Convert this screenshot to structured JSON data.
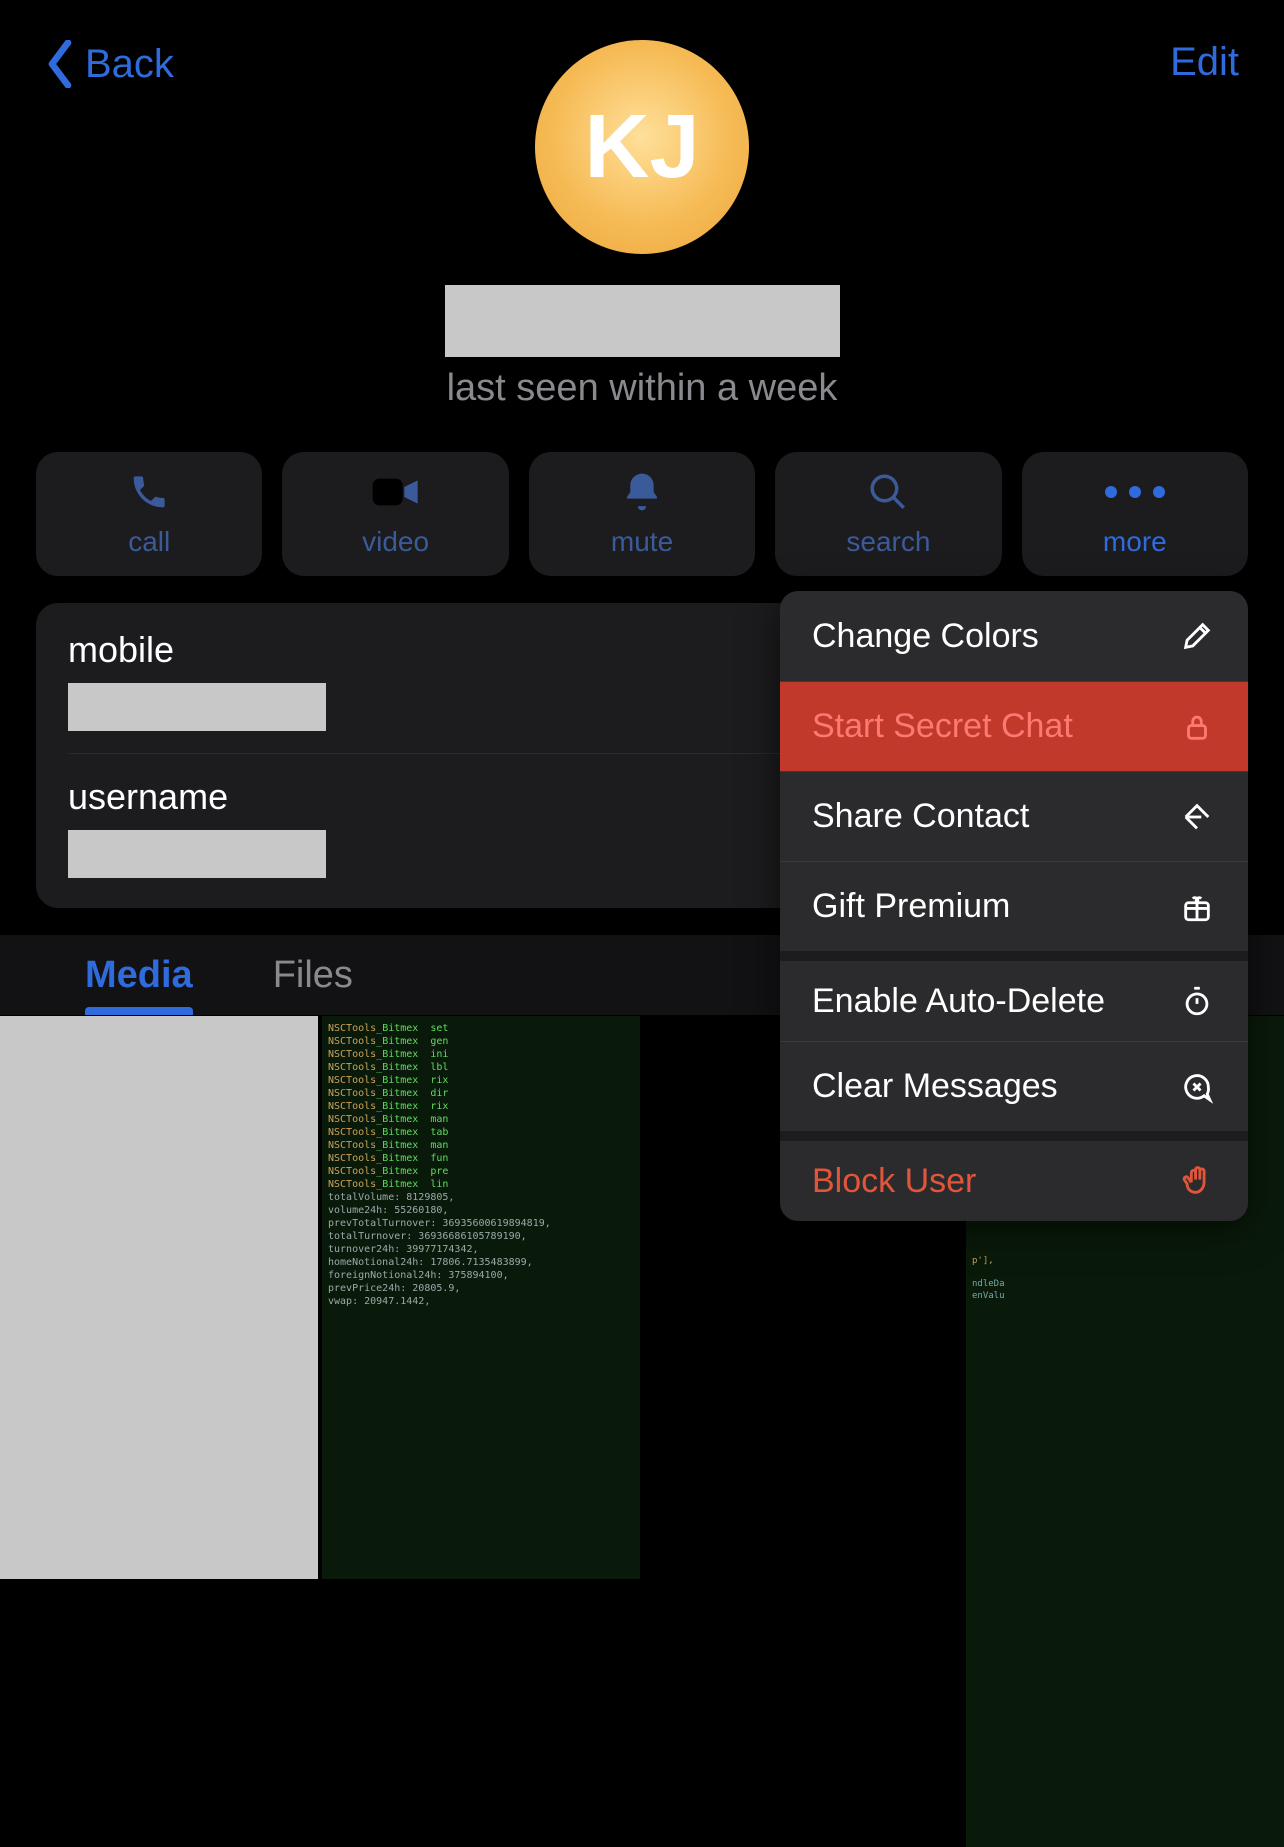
{
  "header": {
    "back": "Back",
    "edit": "Edit"
  },
  "profile": {
    "initials": "KJ",
    "status": "last seen within a week",
    "mobile_label": "mobile",
    "username_label": "username"
  },
  "actions": [
    {
      "name": "call",
      "label": "call"
    },
    {
      "name": "video",
      "label": "video"
    },
    {
      "name": "mute",
      "label": "mute"
    },
    {
      "name": "search",
      "label": "search"
    },
    {
      "name": "more",
      "label": "more"
    }
  ],
  "tabs": [
    {
      "label": "Media",
      "active": true
    },
    {
      "label": "Files",
      "active": false
    }
  ],
  "menu": [
    {
      "label": "Change Colors",
      "icon": "brush-icon",
      "style": "normal"
    },
    {
      "label": "Start Secret Chat",
      "icon": "lock-icon",
      "style": "highlight"
    },
    {
      "label": "Share Contact",
      "icon": "share-icon",
      "style": "normal"
    },
    {
      "label": "Gift Premium",
      "icon": "gift-icon",
      "style": "normal"
    },
    {
      "label": "Enable Auto-Delete",
      "icon": "timer-icon",
      "style": "section"
    },
    {
      "label": "Clear Messages",
      "icon": "bubble-x-icon",
      "style": "normal"
    },
    {
      "label": "Block User",
      "icon": "hand-icon",
      "style": "danger section"
    }
  ]
}
